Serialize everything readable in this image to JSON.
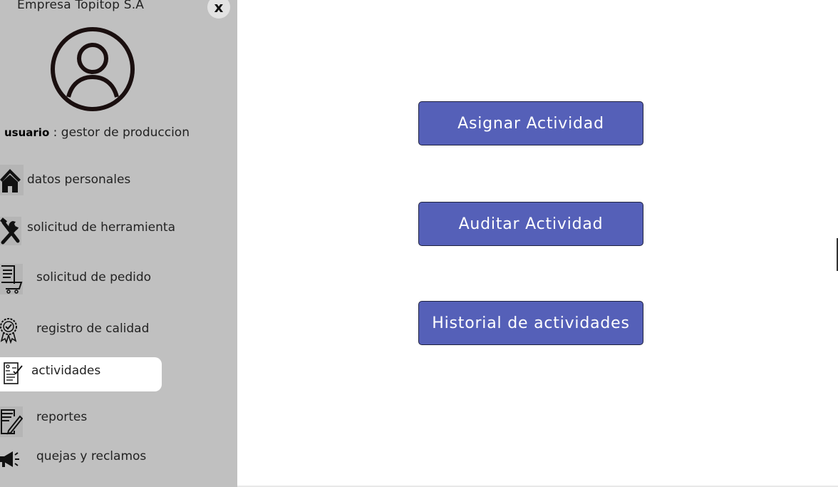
{
  "sidebar": {
    "company": "Empresa Topitop S.A",
    "close_label": "x",
    "user_label": "usuario",
    "user_value": " : gestor de produccion",
    "items": [
      {
        "label": "datos personales",
        "icon": "home-icon"
      },
      {
        "label": "solicitud de herramienta",
        "icon": "tools-icon"
      },
      {
        "label": "solicitud de pedido",
        "icon": "order-cart-icon"
      },
      {
        "label": "registro de calidad",
        "icon": "quality-badge-icon"
      },
      {
        "label": "actividades",
        "icon": "activities-clipboard-icon",
        "active": true
      },
      {
        "label": "reportes",
        "icon": "report-edit-icon"
      },
      {
        "label": "quejas y reclamos",
        "icon": "megaphone-icon"
      }
    ]
  },
  "main": {
    "buttons": [
      "Asignar Actividad",
      "Auditar Actividad",
      "Historial de actividades"
    ]
  },
  "colors": {
    "sidebar_bg": "#c0c0c0",
    "button_bg": "#5560b8",
    "active_item_bg": "#ffffff"
  }
}
